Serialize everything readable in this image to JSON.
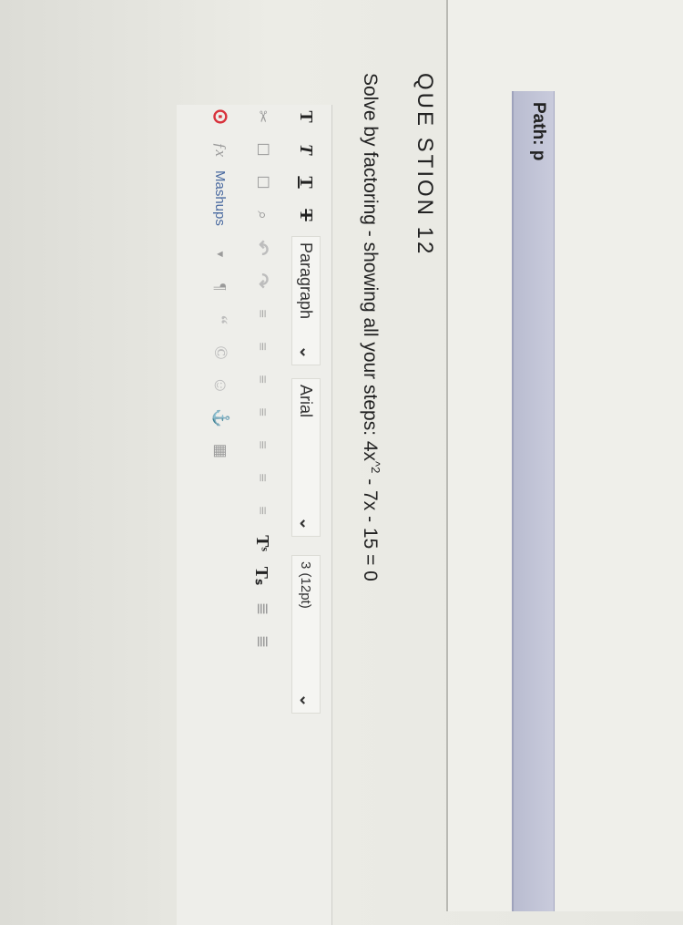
{
  "path_bar": {
    "label": "Path: p"
  },
  "question": {
    "title": "QUE STION 12",
    "prompt": "Solve by factoring - showing all your steps:  4x",
    "exponent": "^2",
    "prompt_rest": " - 7x - 15 = 0"
  },
  "toolbar": {
    "row1": {
      "format_buttons": [
        "T",
        "T",
        "T",
        "T"
      ],
      "paragraph_select": "Paragraph",
      "font_select": "Arial",
      "size_select": "3 (12pt)"
    },
    "row2": {
      "buttons": [
        "✂",
        "☐",
        "☐",
        "⌕",
        "↶",
        "↷",
        "≡",
        "≡",
        "≡",
        "≡",
        "≡",
        "≡",
        "≡",
        "Tˢ",
        "Tₛ",
        "≣",
        "≣"
      ]
    },
    "row3": {
      "buttons": [
        "⊙",
        "ƒx",
        "Mashups",
        "▾",
        "¶",
        "“",
        "©",
        "☺",
        "⚓",
        "▦"
      ]
    }
  }
}
